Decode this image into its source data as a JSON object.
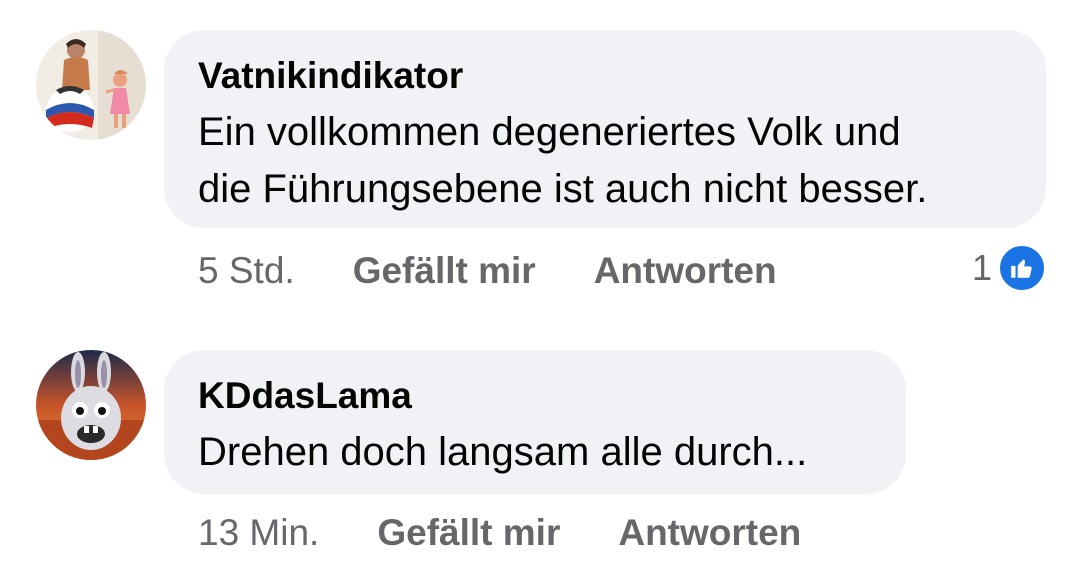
{
  "colors": {
    "bubble": "#f0f2f5",
    "secondary_text": "#65676b",
    "like_blue": "#1b74e4"
  },
  "comments": [
    {
      "author": "Vatnikindikator",
      "text_lines": [
        "Ein vollkommen degeneriertes Volk und",
        "die Führungsebene ist auch nicht besser."
      ],
      "time": "5 Std.",
      "like_label": "Gefällt mir",
      "reply_label": "Antworten",
      "reaction_count": "1",
      "reaction_icon": "thumbs-up-icon"
    },
    {
      "author": "KDdasLama",
      "text_lines": [
        "Drehen doch langsam alle durch..."
      ],
      "time": "13 Min.",
      "like_label": "Gefällt mir",
      "reply_label": "Antworten"
    }
  ]
}
